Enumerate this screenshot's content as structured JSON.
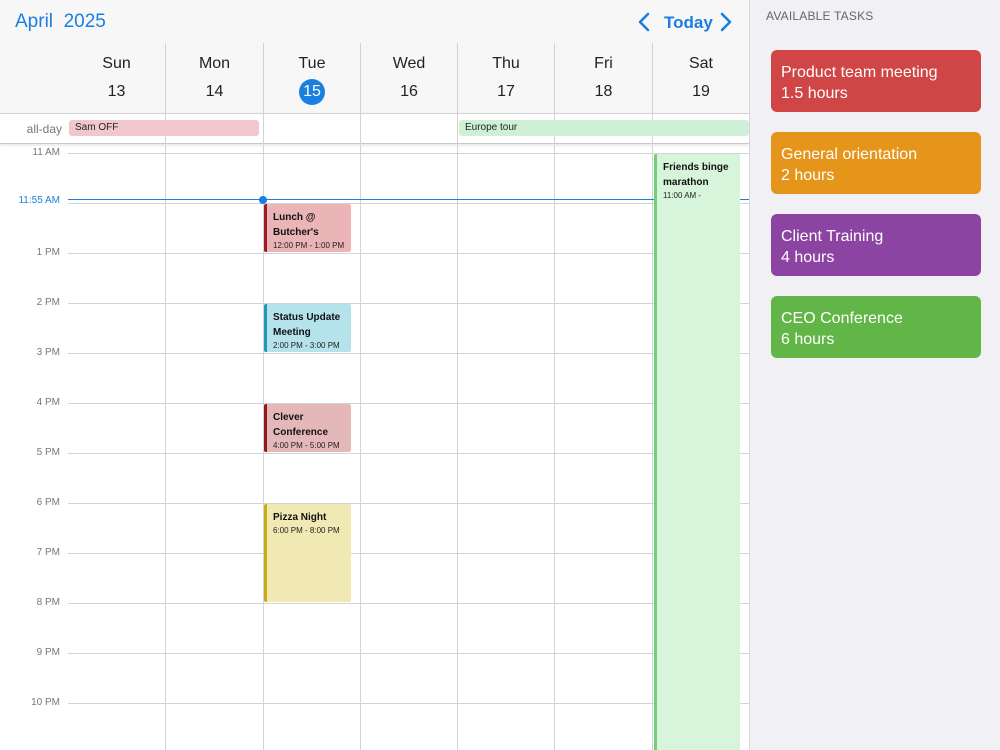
{
  "header": {
    "month": "April",
    "year": "2025",
    "today_label": "Today"
  },
  "days": [
    {
      "name": "Sun",
      "num": "13"
    },
    {
      "name": "Mon",
      "num": "14"
    },
    {
      "name": "Tue",
      "num": "15",
      "is_today": true
    },
    {
      "name": "Wed",
      "num": "16"
    },
    {
      "name": "Thu",
      "num": "17"
    },
    {
      "name": "Fri",
      "num": "18"
    },
    {
      "name": "Sat",
      "num": "19"
    }
  ],
  "allday": {
    "label": "all-day",
    "events": [
      {
        "title": "Sam OFF",
        "color": "#f0c8cc"
      },
      {
        "title": "Europe tour",
        "color": "#cdf0d6"
      }
    ]
  },
  "hours": [
    "11 AM",
    "1 PM",
    "2 PM",
    "3 PM",
    "4 PM",
    "5 PM",
    "6 PM",
    "7 PM",
    "8 PM",
    "9 PM",
    "10 PM"
  ],
  "now": {
    "label": "11:55 AM",
    "color": "#1a7fe0"
  },
  "events": [
    {
      "title": "Lunch @ Butcher's",
      "time": "12:00 PM - 1:00 PM",
      "bg": "#ebb4b7",
      "border": "#9b1c22"
    },
    {
      "title": "Status Update Meeting",
      "time": "2:00 PM - 3:00 PM",
      "bg": "#b4e3ec",
      "border": "#1f9ab2"
    },
    {
      "title": "Clever Conference",
      "time": "4:00 PM - 5:00 PM",
      "bg": "#e4b8b8",
      "border": "#8e1a1a"
    },
    {
      "title": "Pizza Night",
      "time": "6:00 PM - 8:00 PM",
      "bg": "#f1e9b4",
      "border": "#c7ac15"
    },
    {
      "title": "Friends binge marathon",
      "time": "11:00 AM -",
      "bg": "#d6f5da",
      "border": "#6fcf7a"
    }
  ],
  "sidebar": {
    "title": "AVAILABLE TASKS",
    "tasks": [
      {
        "name": "Product team meeting",
        "duration": "1.5 hours",
        "color": "#d04545"
      },
      {
        "name": "General orientation",
        "duration": "2 hours",
        "color": "#e5951a"
      },
      {
        "name": "Client Training",
        "duration": "4 hours",
        "color": "#8b44a2"
      },
      {
        "name": "CEO Conference",
        "duration": "6 hours",
        "color": "#62b647"
      }
    ]
  },
  "icons": {
    "prev": "chevron-left-icon",
    "next": "chevron-right-icon"
  }
}
